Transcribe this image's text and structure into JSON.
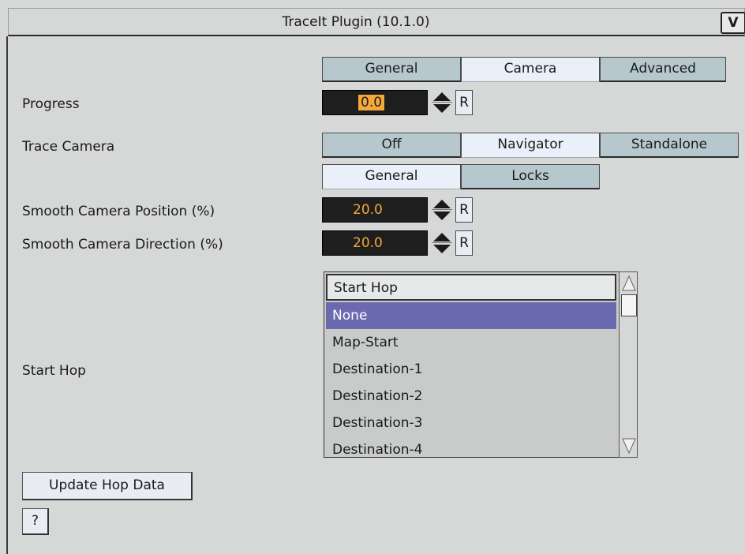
{
  "window": {
    "title": "TraceIt Plugin (10.1.0)",
    "logo_icon": "plugin-logo-icon"
  },
  "top_tabs": {
    "items": [
      {
        "label": "General",
        "active": false
      },
      {
        "label": "Camera",
        "active": true
      },
      {
        "label": "Advanced",
        "active": false
      }
    ]
  },
  "progress": {
    "label": "Progress",
    "value": "0.0",
    "reset_label": "R"
  },
  "trace_camera": {
    "label": "Trace Camera",
    "options": [
      {
        "label": "Off",
        "active": false
      },
      {
        "label": "Navigator",
        "active": true
      },
      {
        "label": "Standalone",
        "active": false
      }
    ]
  },
  "camera_subtabs": {
    "items": [
      {
        "label": "General",
        "active": true
      },
      {
        "label": "Locks",
        "active": false
      }
    ]
  },
  "smooth_position": {
    "label": "Smooth Camera Position (%)",
    "value": "20.0",
    "reset_label": "R"
  },
  "smooth_direction": {
    "label": "Smooth Camera Direction (%)",
    "value": "20.0",
    "reset_label": "R"
  },
  "start_hop": {
    "label": "Start Hop",
    "list_header": "Start Hop",
    "items": [
      "None",
      "Map-Start",
      "Destination-1",
      "Destination-2",
      "Destination-3",
      "Destination-4"
    ],
    "selected_index": 0
  },
  "buttons": {
    "update_hop_data": "Update Hop Data",
    "help": "?"
  },
  "colors": {
    "panel_bg": "#d6d7d7",
    "tab_inactive": "#b6c8ce",
    "tab_active": "#e9f0fa",
    "field_bg": "#1e1e1e",
    "field_text": "#f2a83a",
    "list_selected": "#6b6ab0"
  }
}
